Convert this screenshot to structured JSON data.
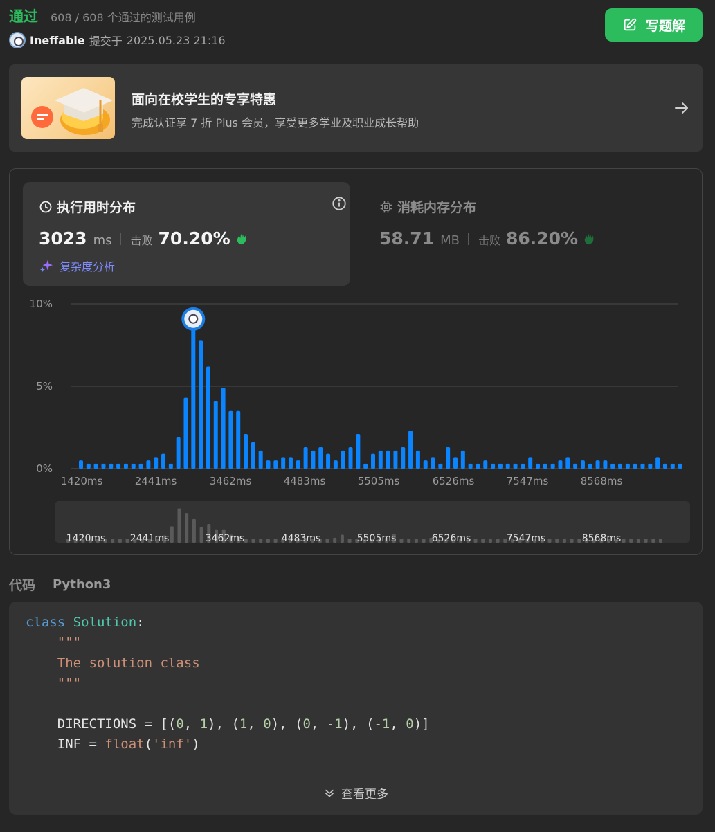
{
  "status": {
    "title": "通过",
    "count": "608 / 608 个通过的测试用例",
    "submitter": "Ineffable",
    "submitted_label": "提交于",
    "submitted_time": "2025.05.23 21:16"
  },
  "actions": {
    "write_solution": "写题解"
  },
  "promo": {
    "title": "面向在校学生的专享特惠",
    "subtitle": "完成认证享 7 折 Plus 会员，享受更多学业及职业成长帮助"
  },
  "runtime": {
    "title": "执行用时分布",
    "value": "3023",
    "unit": "ms",
    "beat_label": "击败",
    "beat_value": "70.20%",
    "complexity_link": "复杂度分析"
  },
  "memory": {
    "title": "消耗内存分布",
    "value": "58.71",
    "unit": "MB",
    "beat_label": "击败",
    "beat_value": "86.20%"
  },
  "chart_data": {
    "type": "bar",
    "ylabel_ticks": [
      "10%",
      "5%",
      "0%"
    ],
    "ylim": [
      0,
      10
    ],
    "x_tick_labels": [
      "1420ms",
      "2441ms",
      "3462ms",
      "4483ms",
      "5505ms",
      "6526ms",
      "7547ms",
      "8568ms"
    ],
    "values": [
      0.5,
      0.3,
      0.3,
      0.3,
      0.3,
      0.3,
      0.3,
      0.3,
      0.3,
      0.5,
      0.7,
      0.9,
      0.3,
      1.9,
      4.3,
      9.0,
      7.8,
      6.2,
      4.1,
      4.9,
      3.5,
      3.5,
      2.1,
      1.6,
      1.1,
      0.5,
      0.5,
      0.7,
      0.7,
      0.5,
      1.3,
      1.1,
      1.3,
      0.9,
      0.5,
      1.1,
      1.3,
      2.1,
      0.3,
      0.9,
      1.1,
      1.1,
      1.1,
      1.3,
      2.3,
      1.1,
      0.5,
      0.7,
      0.3,
      1.3,
      0.7,
      1.1,
      0.3,
      0.3,
      0.5,
      0.3,
      0.3,
      0.3,
      0.3,
      0.3,
      0.7,
      0.3,
      0.3,
      0.3,
      0.5,
      0.7,
      0.3,
      0.5,
      0.3,
      0.5,
      0.5,
      0.3,
      0.3,
      0.3,
      0.3,
      0.3,
      0.3,
      0.7,
      0.3,
      0.3,
      0.3
    ],
    "highlight_index": 15,
    "minimap_x_tick_labels": [
      "1420ms",
      "2441ms",
      "3462ms",
      "4483ms",
      "5505ms",
      "6526ms",
      "7547ms",
      "8568ms"
    ],
    "bar_color": "#0a84ff",
    "minimap_bar_color": "#5a5a5a",
    "grid": true
  },
  "code": {
    "label": "代码",
    "language": "Python3",
    "show_more": "查看更多"
  },
  "colors": {
    "accent_green": "#2cbb5d",
    "bar_blue": "#0a84ff",
    "link_purple": "#7f8cff"
  }
}
